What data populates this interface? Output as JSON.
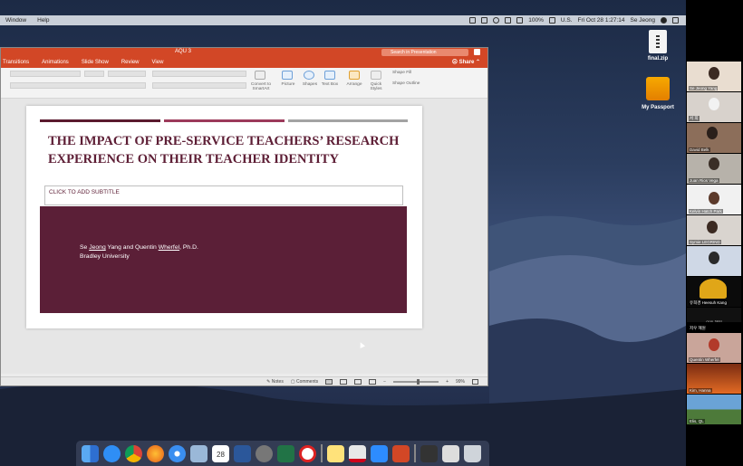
{
  "menubar": {
    "items": [
      "Window",
      "Help"
    ],
    "battery": "100%",
    "locale": "U.S.",
    "clock": "Fri Oct 28  1:27:14",
    "user": "Se Jeong"
  },
  "desktop_icons": [
    {
      "label": "final.zip",
      "icon": "zip-file-icon"
    },
    {
      "label": "My Passport",
      "icon": "external-drive-icon"
    }
  ],
  "ppt": {
    "doc_title": "AQU 3",
    "search_placeholder": "Search in Presentation",
    "tabs": [
      "Transitions",
      "Animations",
      "Slide Show",
      "Review",
      "View"
    ],
    "share_label": "Share",
    "ribbon": {
      "convert": "Convert to SmartArt",
      "picture": "Picture",
      "shapes": "Shapes",
      "textbox": "Text Box",
      "arrange": "Arrange",
      "quick_styles": "Quick Styles",
      "shape_fill": "Shape Fill",
      "shape_outline": "Shape Outline"
    },
    "slide": {
      "title": "THE IMPACT OF PRE-SERVICE TEACHERS’ RESEARCH EXPERIENCE ON THEIR TEACHER IDENTITY",
      "subtitle_placeholder": "CLICK TO ADD SUBTITLE",
      "authors_pre": "Se ",
      "authors_u1": "Jeong",
      "authors_mid": " Yang and Quentin ",
      "authors_u2": "Wherfel",
      "authors_post": ", Ph.D.",
      "affiliation": "Bradley University",
      "bar_colors": [
        "#5a1a2e",
        "#9c3a5a",
        "#a3a3a3"
      ],
      "maroon": "#5b1f37"
    },
    "notes_tag": "es",
    "status": {
      "notes": "Notes",
      "comments": "Comments",
      "zoom": "99%"
    }
  },
  "dock": {
    "apps": [
      "finder-icon",
      "app-store-icon",
      "chrome-icon",
      "firefox-icon",
      "safari-icon",
      "preview-icon",
      "calendar-icon",
      "word-icon",
      "system-prefs-icon",
      "excel-icon",
      "no-entry-icon",
      "notes-icon",
      "acrobat-icon",
      "zoom-icon",
      "powerpoint-icon",
      "screenshot-icon",
      "gallery-icon",
      "trash-icon"
    ],
    "calendar_day": "28"
  },
  "gallery": {
    "participants": [
      {
        "name": "Se Jeong Yang"
      },
      {
        "name": "서 희"
      },
      {
        "name": "David Belk"
      },
      {
        "name": "Juan Rios Vega"
      },
      {
        "name": "Kelvin Hatch Park"
      },
      {
        "name": "Symie LEGRIND"
      },
      {
        "name": ""
      },
      {
        "name": "유희경 Heesuh Kang"
      },
      {
        "name": "이유 혜원"
      },
      {
        "name": "저우 혜원"
      },
      {
        "name": "Quentin Wherfel"
      },
      {
        "name": "Kim, Hanna"
      },
      {
        "name": "Elis, QL"
      }
    ]
  }
}
